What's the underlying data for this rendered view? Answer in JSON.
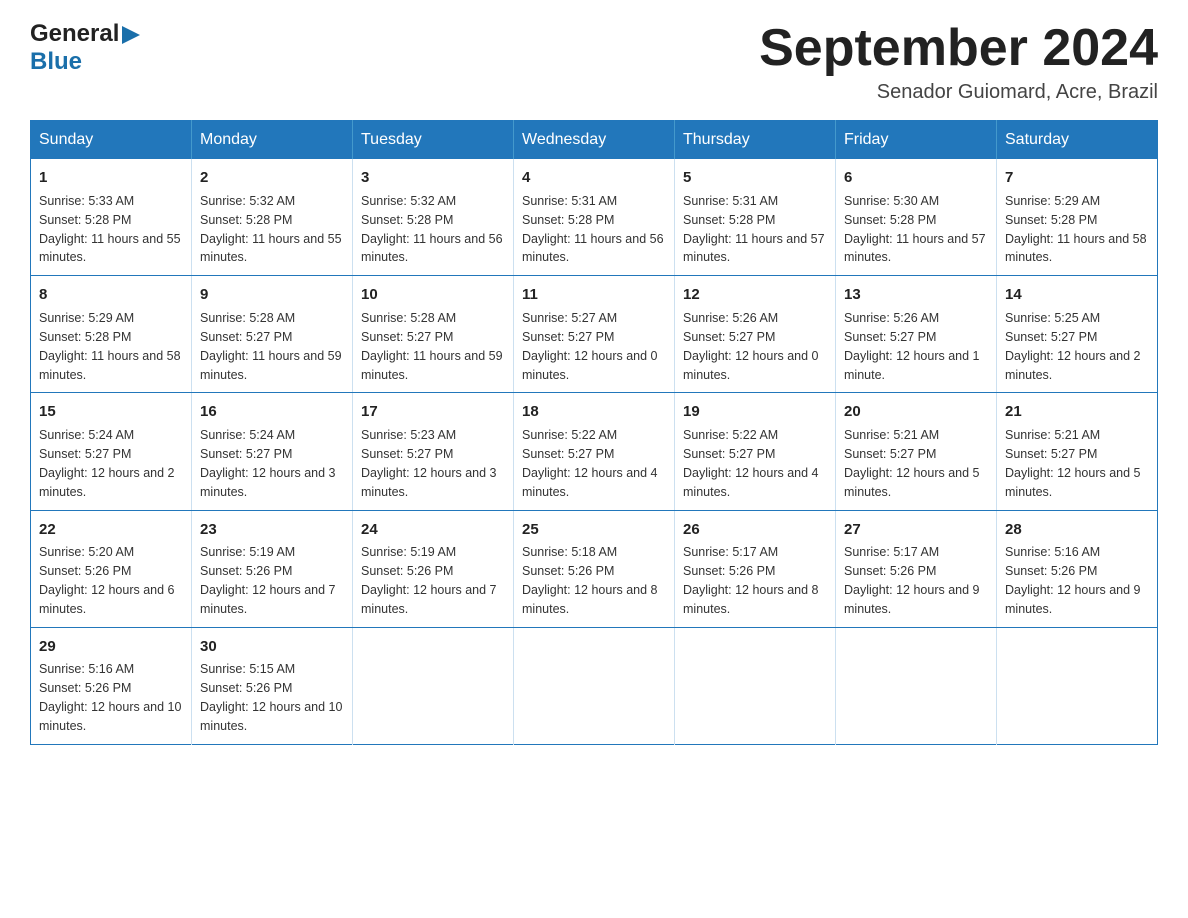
{
  "header": {
    "logo_general": "General",
    "logo_blue": "Blue",
    "month_title": "September 2024",
    "location": "Senador Guiomard, Acre, Brazil"
  },
  "weekdays": [
    "Sunday",
    "Monday",
    "Tuesday",
    "Wednesday",
    "Thursday",
    "Friday",
    "Saturday"
  ],
  "weeks": [
    [
      {
        "day": "1",
        "sunrise": "Sunrise: 5:33 AM",
        "sunset": "Sunset: 5:28 PM",
        "daylight": "Daylight: 11 hours and 55 minutes."
      },
      {
        "day": "2",
        "sunrise": "Sunrise: 5:32 AM",
        "sunset": "Sunset: 5:28 PM",
        "daylight": "Daylight: 11 hours and 55 minutes."
      },
      {
        "day": "3",
        "sunrise": "Sunrise: 5:32 AM",
        "sunset": "Sunset: 5:28 PM",
        "daylight": "Daylight: 11 hours and 56 minutes."
      },
      {
        "day": "4",
        "sunrise": "Sunrise: 5:31 AM",
        "sunset": "Sunset: 5:28 PM",
        "daylight": "Daylight: 11 hours and 56 minutes."
      },
      {
        "day": "5",
        "sunrise": "Sunrise: 5:31 AM",
        "sunset": "Sunset: 5:28 PM",
        "daylight": "Daylight: 11 hours and 57 minutes."
      },
      {
        "day": "6",
        "sunrise": "Sunrise: 5:30 AM",
        "sunset": "Sunset: 5:28 PM",
        "daylight": "Daylight: 11 hours and 57 minutes."
      },
      {
        "day": "7",
        "sunrise": "Sunrise: 5:29 AM",
        "sunset": "Sunset: 5:28 PM",
        "daylight": "Daylight: 11 hours and 58 minutes."
      }
    ],
    [
      {
        "day": "8",
        "sunrise": "Sunrise: 5:29 AM",
        "sunset": "Sunset: 5:28 PM",
        "daylight": "Daylight: 11 hours and 58 minutes."
      },
      {
        "day": "9",
        "sunrise": "Sunrise: 5:28 AM",
        "sunset": "Sunset: 5:27 PM",
        "daylight": "Daylight: 11 hours and 59 minutes."
      },
      {
        "day": "10",
        "sunrise": "Sunrise: 5:28 AM",
        "sunset": "Sunset: 5:27 PM",
        "daylight": "Daylight: 11 hours and 59 minutes."
      },
      {
        "day": "11",
        "sunrise": "Sunrise: 5:27 AM",
        "sunset": "Sunset: 5:27 PM",
        "daylight": "Daylight: 12 hours and 0 minutes."
      },
      {
        "day": "12",
        "sunrise": "Sunrise: 5:26 AM",
        "sunset": "Sunset: 5:27 PM",
        "daylight": "Daylight: 12 hours and 0 minutes."
      },
      {
        "day": "13",
        "sunrise": "Sunrise: 5:26 AM",
        "sunset": "Sunset: 5:27 PM",
        "daylight": "Daylight: 12 hours and 1 minute."
      },
      {
        "day": "14",
        "sunrise": "Sunrise: 5:25 AM",
        "sunset": "Sunset: 5:27 PM",
        "daylight": "Daylight: 12 hours and 2 minutes."
      }
    ],
    [
      {
        "day": "15",
        "sunrise": "Sunrise: 5:24 AM",
        "sunset": "Sunset: 5:27 PM",
        "daylight": "Daylight: 12 hours and 2 minutes."
      },
      {
        "day": "16",
        "sunrise": "Sunrise: 5:24 AM",
        "sunset": "Sunset: 5:27 PM",
        "daylight": "Daylight: 12 hours and 3 minutes."
      },
      {
        "day": "17",
        "sunrise": "Sunrise: 5:23 AM",
        "sunset": "Sunset: 5:27 PM",
        "daylight": "Daylight: 12 hours and 3 minutes."
      },
      {
        "day": "18",
        "sunrise": "Sunrise: 5:22 AM",
        "sunset": "Sunset: 5:27 PM",
        "daylight": "Daylight: 12 hours and 4 minutes."
      },
      {
        "day": "19",
        "sunrise": "Sunrise: 5:22 AM",
        "sunset": "Sunset: 5:27 PM",
        "daylight": "Daylight: 12 hours and 4 minutes."
      },
      {
        "day": "20",
        "sunrise": "Sunrise: 5:21 AM",
        "sunset": "Sunset: 5:27 PM",
        "daylight": "Daylight: 12 hours and 5 minutes."
      },
      {
        "day": "21",
        "sunrise": "Sunrise: 5:21 AM",
        "sunset": "Sunset: 5:27 PM",
        "daylight": "Daylight: 12 hours and 5 minutes."
      }
    ],
    [
      {
        "day": "22",
        "sunrise": "Sunrise: 5:20 AM",
        "sunset": "Sunset: 5:26 PM",
        "daylight": "Daylight: 12 hours and 6 minutes."
      },
      {
        "day": "23",
        "sunrise": "Sunrise: 5:19 AM",
        "sunset": "Sunset: 5:26 PM",
        "daylight": "Daylight: 12 hours and 7 minutes."
      },
      {
        "day": "24",
        "sunrise": "Sunrise: 5:19 AM",
        "sunset": "Sunset: 5:26 PM",
        "daylight": "Daylight: 12 hours and 7 minutes."
      },
      {
        "day": "25",
        "sunrise": "Sunrise: 5:18 AM",
        "sunset": "Sunset: 5:26 PM",
        "daylight": "Daylight: 12 hours and 8 minutes."
      },
      {
        "day": "26",
        "sunrise": "Sunrise: 5:17 AM",
        "sunset": "Sunset: 5:26 PM",
        "daylight": "Daylight: 12 hours and 8 minutes."
      },
      {
        "day": "27",
        "sunrise": "Sunrise: 5:17 AM",
        "sunset": "Sunset: 5:26 PM",
        "daylight": "Daylight: 12 hours and 9 minutes."
      },
      {
        "day": "28",
        "sunrise": "Sunrise: 5:16 AM",
        "sunset": "Sunset: 5:26 PM",
        "daylight": "Daylight: 12 hours and 9 minutes."
      }
    ],
    [
      {
        "day": "29",
        "sunrise": "Sunrise: 5:16 AM",
        "sunset": "Sunset: 5:26 PM",
        "daylight": "Daylight: 12 hours and 10 minutes."
      },
      {
        "day": "30",
        "sunrise": "Sunrise: 5:15 AM",
        "sunset": "Sunset: 5:26 PM",
        "daylight": "Daylight: 12 hours and 10 minutes."
      },
      null,
      null,
      null,
      null,
      null
    ]
  ]
}
